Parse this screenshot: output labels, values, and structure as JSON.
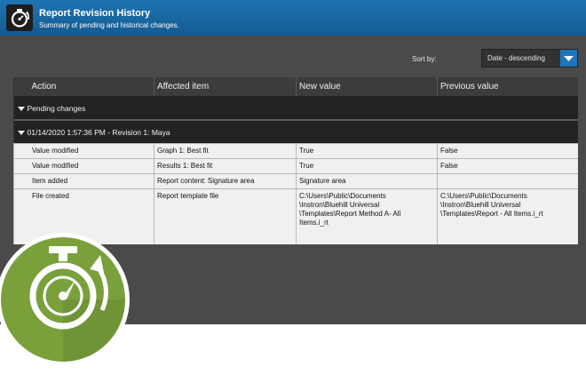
{
  "header": {
    "title": "Report Revision History",
    "subtitle": "Summary of pending and historical changes."
  },
  "sort": {
    "label": "Sort by:",
    "value": "Date - descending"
  },
  "table": {
    "columns": [
      "Action",
      "Affected item",
      "New value",
      "Previous value"
    ],
    "pending_label": "Pending changes",
    "revision_label": "01/14/2020 1:57:36 PM - Revision 1: Maya",
    "rows": [
      {
        "action": "Value modified",
        "item": "Graph 1: Best fit",
        "new": "True",
        "previous": "False"
      },
      {
        "action": "Value modified",
        "item": "Results 1: Best fit",
        "new": "True",
        "previous": "False"
      },
      {
        "action": "Item added",
        "item": "Report content: Signature area",
        "new": "Signature area",
        "previous": ""
      },
      {
        "action": "File created",
        "item": "Report template file",
        "new_lines": [
          "C:\\Users\\Public\\Documents",
          "\\Instron\\Bluehill Universal",
          "\\Templates\\Report Method A- All",
          "Items.i_rt"
        ],
        "previous_lines": [
          "C:\\Users\\Public\\Documents",
          "\\Instron\\Bluehill Universal",
          "\\Templates\\Report - All Items.i_rt"
        ]
      }
    ]
  },
  "colors": {
    "header_blue": "#1a6aa8",
    "accent_blue": "#1c76be",
    "badge_green": "#7aa03c"
  },
  "icons": {
    "title": "stopwatch-icon",
    "badge": "revision-history-badge-icon",
    "sort": "chevron-down-icon"
  }
}
